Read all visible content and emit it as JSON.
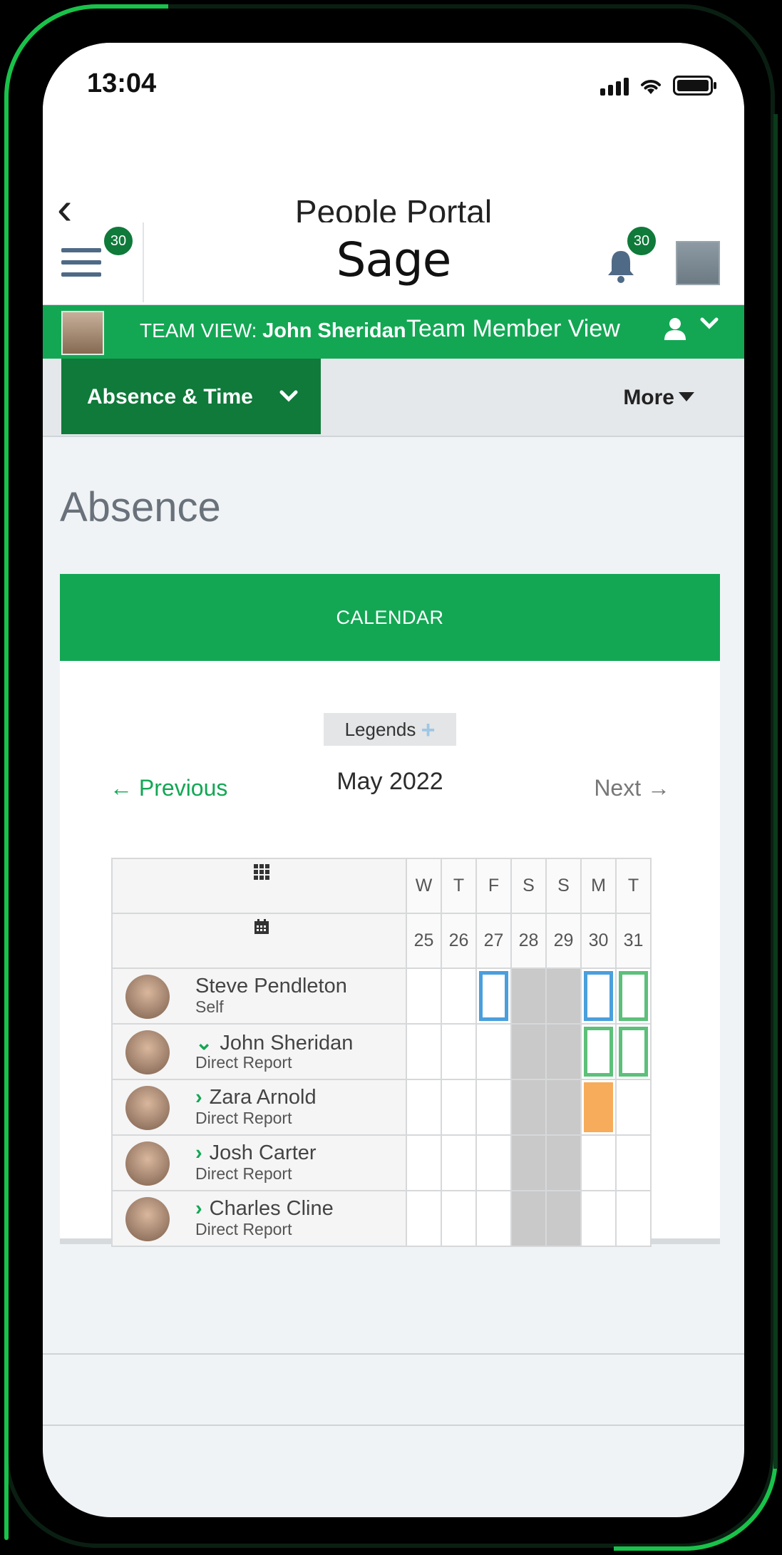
{
  "status_bar": {
    "time": "13:04"
  },
  "nav": {
    "title": "People Portal",
    "back_glyph": "‹"
  },
  "appbar": {
    "logo": "Sage",
    "menu_badge": "30",
    "bell_badge": "30"
  },
  "team_bar": {
    "prefix": "TEAM VIEW:",
    "name": "John Sheridan",
    "view": "Team Member View"
  },
  "tabs": {
    "active": "Absence & Time",
    "more": "More"
  },
  "page_title": "Absence",
  "calendar": {
    "header": "CALENDAR",
    "legends": "Legends",
    "prev": "← Previous",
    "month": "May 2022",
    "next": "Next →",
    "weekdays": [
      "W",
      "T",
      "F",
      "S",
      "S",
      "M",
      "T"
    ],
    "dates": [
      "25",
      "26",
      "27",
      "28",
      "29",
      "30",
      "31"
    ],
    "people": [
      {
        "name": "Steve Pendleton",
        "role": "Self",
        "chevron": "",
        "marks": [
          "",
          "",
          "blue",
          "wknd",
          "wknd",
          "blue",
          "green"
        ]
      },
      {
        "name": "John Sheridan",
        "role": "Direct Report",
        "chevron": "⌄",
        "marks": [
          "",
          "",
          "",
          "wknd",
          "wknd",
          "green",
          "green"
        ]
      },
      {
        "name": "Zara Arnold",
        "role": "Direct Report",
        "chevron": "›",
        "marks": [
          "",
          "",
          "",
          "wknd",
          "wknd",
          "orange",
          ""
        ]
      },
      {
        "name": "Josh Carter",
        "role": "Direct Report",
        "chevron": "›",
        "marks": [
          "",
          "",
          "",
          "wknd",
          "wknd",
          "",
          ""
        ]
      },
      {
        "name": "Charles Cline",
        "role": "Direct Report",
        "chevron": "›",
        "marks": [
          "",
          "",
          "",
          "wknd",
          "wknd",
          "",
          ""
        ]
      }
    ]
  },
  "colors": {
    "brand_green": "#13a754",
    "dark_green": "#0f7a3a",
    "mark_blue": "#4a9fdc",
    "mark_green": "#5cc07a",
    "mark_orange": "#f6ac5a"
  }
}
